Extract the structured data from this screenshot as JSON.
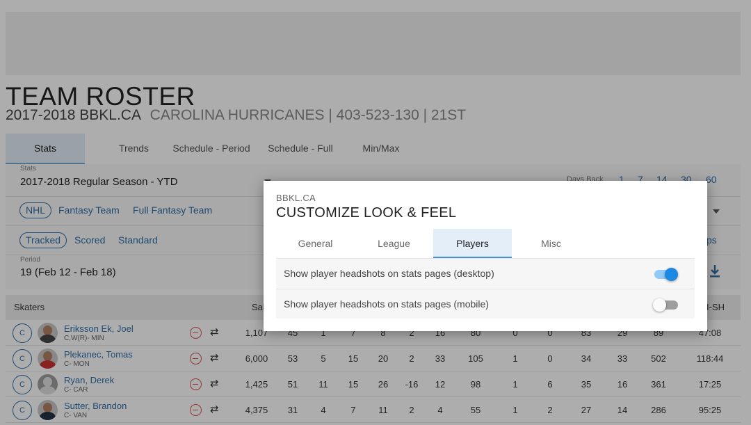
{
  "page": {
    "title": "TEAM ROSTER",
    "league": "2017-2018 BBKL.CA",
    "team_line": "CAROLINA HURRICANES | 403-523-130 | 21ST"
  },
  "tabs": [
    {
      "label": "Stats",
      "active": true
    },
    {
      "label": "Trends"
    },
    {
      "label": "Schedule - Period"
    },
    {
      "label": "Schedule - Full"
    },
    {
      "label": "Min/Max"
    }
  ],
  "filters": {
    "stats_label": "Stats",
    "stats_value": "2017-2018 Regular Season - YTD",
    "days_back_label": "Days Back",
    "days_back": [
      "1",
      "7",
      "14",
      "30",
      "60"
    ],
    "source_chip": "NHL",
    "source_links": [
      "Fantasy Team",
      "Full Fantasy Team"
    ],
    "mode_chip": "Tracked",
    "mode_links": [
      "Scored",
      "Standard"
    ],
    "partial_link": "ps",
    "period_label": "Period",
    "period_value": "19 (Feb 12 - Feb 18)"
  },
  "table": {
    "skaters_header": "Skaters",
    "sal_header": "Sal",
    "last_header": "I-SH",
    "rows": [
      {
        "pos": "C",
        "name": "Eriksson Ek, Joel",
        "info": "C,W(R)- MIN",
        "cells": [
          "1,107",
          "45",
          "1",
          "7",
          "8",
          "2",
          "16",
          "80",
          "0",
          "0",
          "83",
          "29",
          "89",
          "47:08"
        ]
      },
      {
        "pos": "C",
        "name": "Plekanec, Tomas",
        "info": "C- MON",
        "cells": [
          "6,000",
          "53",
          "5",
          "15",
          "20",
          "2",
          "33",
          "105",
          "1",
          "0",
          "34",
          "33",
          "502",
          "118:44"
        ]
      },
      {
        "pos": "C",
        "name": "Ryan, Derek",
        "info": "C- CAR",
        "cells": [
          "1,425",
          "51",
          "11",
          "15",
          "26",
          "-16",
          "12",
          "98",
          "1",
          "6",
          "35",
          "16",
          "361",
          "17:25"
        ]
      },
      {
        "pos": "C",
        "name": "Sutter, Brandon",
        "info": "C- VAN",
        "cells": [
          "4,375",
          "31",
          "4",
          "7",
          "11",
          "2",
          "4",
          "55",
          "1",
          "2",
          "27",
          "14",
          "286",
          "95:25"
        ]
      }
    ]
  },
  "modal": {
    "kicker": "BBKL.CA",
    "title": "CUSTOMIZE LOOK & FEEL",
    "tabs": [
      {
        "label": "General"
      },
      {
        "label": "League"
      },
      {
        "label": "Players",
        "active": true
      },
      {
        "label": "Misc"
      }
    ],
    "settings": [
      {
        "label": "Show player headshots on stats pages (desktop)",
        "enabled": true
      },
      {
        "label": "Show player headshots on stats pages (mobile)",
        "enabled": false
      }
    ]
  },
  "colors": {
    "link_blue": "#2f6ea8",
    "toggle_on": "#1e88e5",
    "remove_red": "#d9534f"
  }
}
